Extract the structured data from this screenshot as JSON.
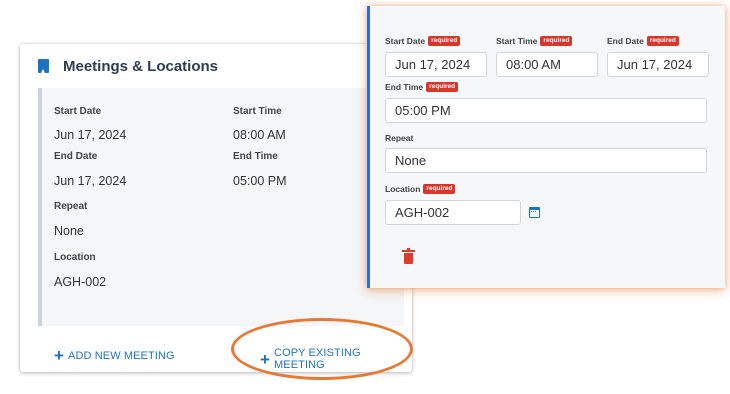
{
  "card": {
    "title": "Meetings & Locations",
    "fields": {
      "start_date_label": "Start Date",
      "start_date": "Jun 17, 2024",
      "start_time_label": "Start Time",
      "start_time": "08:00 AM",
      "end_date_label": "End Date",
      "end_date": "Jun 17, 2024",
      "end_time_label": "End Time",
      "end_time": "05:00 PM",
      "repeat_label": "Repeat",
      "repeat": "None",
      "location_label": "Location",
      "location": "AGH-002"
    },
    "actions": {
      "add_new": "ADD NEW MEETING",
      "copy_existing": "COPY EXISTING MEETING"
    }
  },
  "edit_panel": {
    "required_tag": "required",
    "start_date_label": "Start Date",
    "start_date": "Jun 17, 2024",
    "start_time_label": "Start Time",
    "start_time": "08:00 AM",
    "end_date_label": "End Date",
    "end_date": "Jun 17, 2024",
    "end_time_label": "End Time",
    "end_time": "05:00 PM",
    "repeat_label": "Repeat",
    "repeat": "None",
    "location_label": "Location",
    "location": "AGH-002"
  },
  "colors": {
    "accent": "#1e73be",
    "required": "#d9362b",
    "highlight": "#e57a34"
  },
  "icons": {
    "header": "bookmark-icon",
    "add": "plus-icon",
    "calendar": "calendar-icon",
    "delete": "trash-icon"
  }
}
